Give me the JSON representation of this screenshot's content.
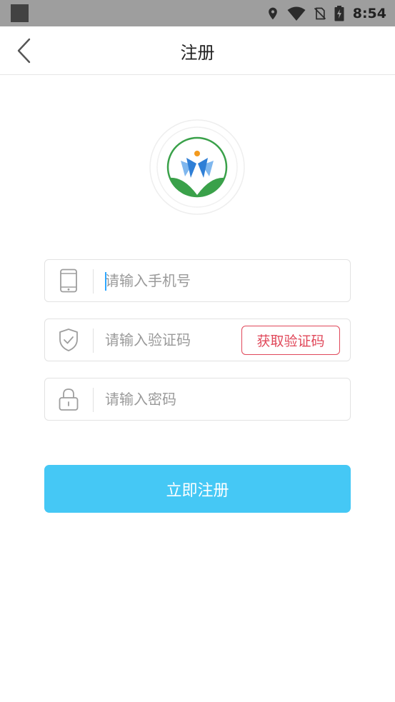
{
  "status_bar": {
    "time": "8:54",
    "icons": [
      "location-icon",
      "wifi-icon",
      "no-sim-icon",
      "battery-charging-icon"
    ]
  },
  "nav": {
    "title": "注册",
    "back_icon": "chevron-left-icon"
  },
  "logo": {
    "name": "app-logo",
    "colors": {
      "green": "#3aa14a",
      "blue": "#2f7fd6",
      "light_blue": "#7fb7ee",
      "orange": "#f39a1e"
    }
  },
  "form": {
    "phone": {
      "placeholder": "请输入手机号",
      "icon": "phone-icon"
    },
    "code": {
      "placeholder": "请输入验证码",
      "icon": "shield-check-icon",
      "button_label": "获取验证码"
    },
    "password": {
      "placeholder": "请输入密码",
      "icon": "lock-icon"
    }
  },
  "register_button": {
    "label": "立即注册"
  },
  "colors": {
    "accent": "#45c8f5",
    "code_button": "#e0485a",
    "status_bar": "#9e9e9e"
  }
}
